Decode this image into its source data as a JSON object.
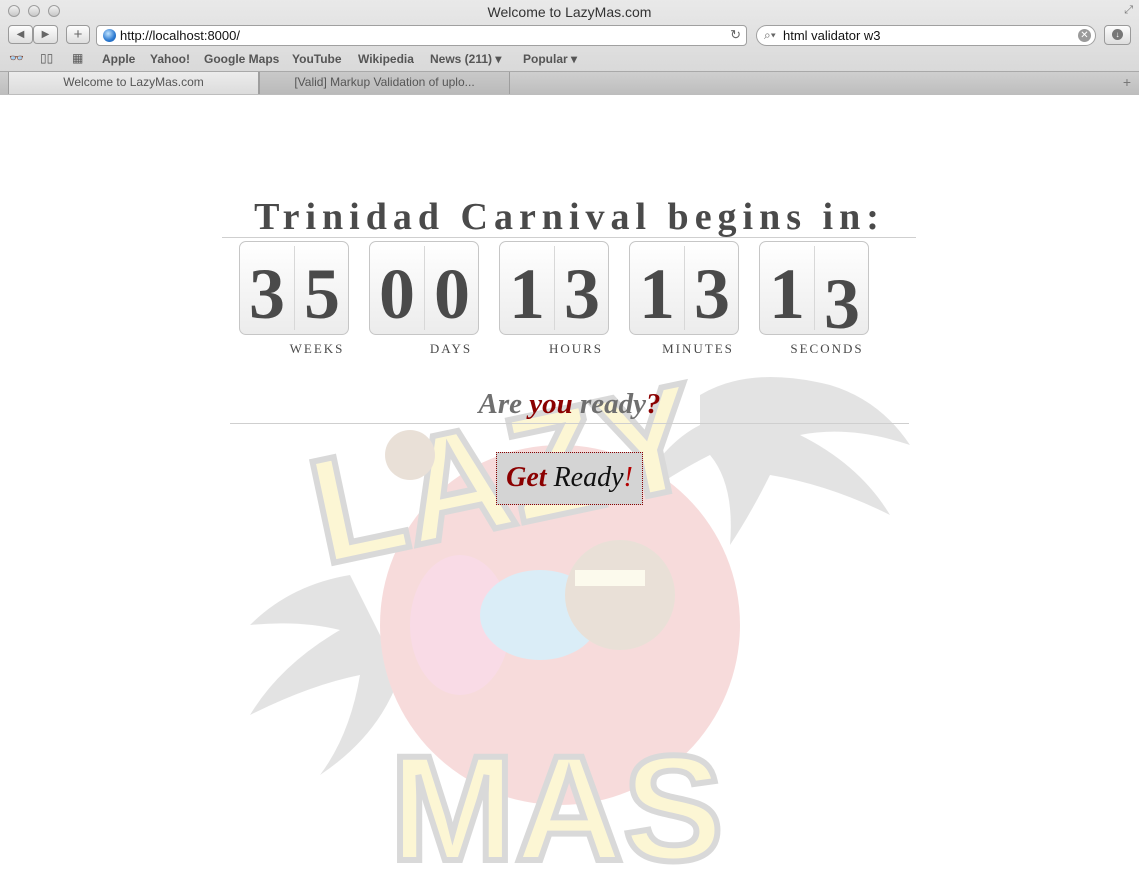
{
  "window": {
    "title": "Welcome to LazyMas.com"
  },
  "toolbar": {
    "back": "◀",
    "forward": "▶",
    "add": "+",
    "url": "http://localhost:8000/",
    "search_value": "html validator w3"
  },
  "bookmarks": [
    "Apple",
    "Yahoo!",
    "Google Maps",
    "YouTube",
    "Wikipedia",
    "News (211) ▾",
    "Popular ▾"
  ],
  "tabs": [
    {
      "label": "Welcome to LazyMas.com"
    },
    {
      "label": "[Valid] Markup Validation of uplo..."
    }
  ],
  "page": {
    "headline": "Trinidad Carnival begins in:",
    "countdown": [
      {
        "unit": "WEEKS",
        "d1": "3",
        "d2": "5"
      },
      {
        "unit": "DAYS",
        "d1": "0",
        "d2": "0"
      },
      {
        "unit": "HOURS",
        "d1": "1",
        "d2": "3"
      },
      {
        "unit": "MINUTES",
        "d1": "1",
        "d2": "3"
      },
      {
        "unit": "SECONDS",
        "d1": "1",
        "d2": "3"
      }
    ],
    "ready": {
      "w1": "Are ",
      "w2": "you",
      "w3": " ready",
      "w4": "?"
    },
    "button": {
      "w1": "Get",
      "w2": " Ready",
      "w3": "!"
    },
    "logo_text": [
      "LAZY",
      "MAS"
    ]
  },
  "colors": {
    "accent_red": "#8b0000",
    "digit_gray": "#4a4a4a"
  }
}
